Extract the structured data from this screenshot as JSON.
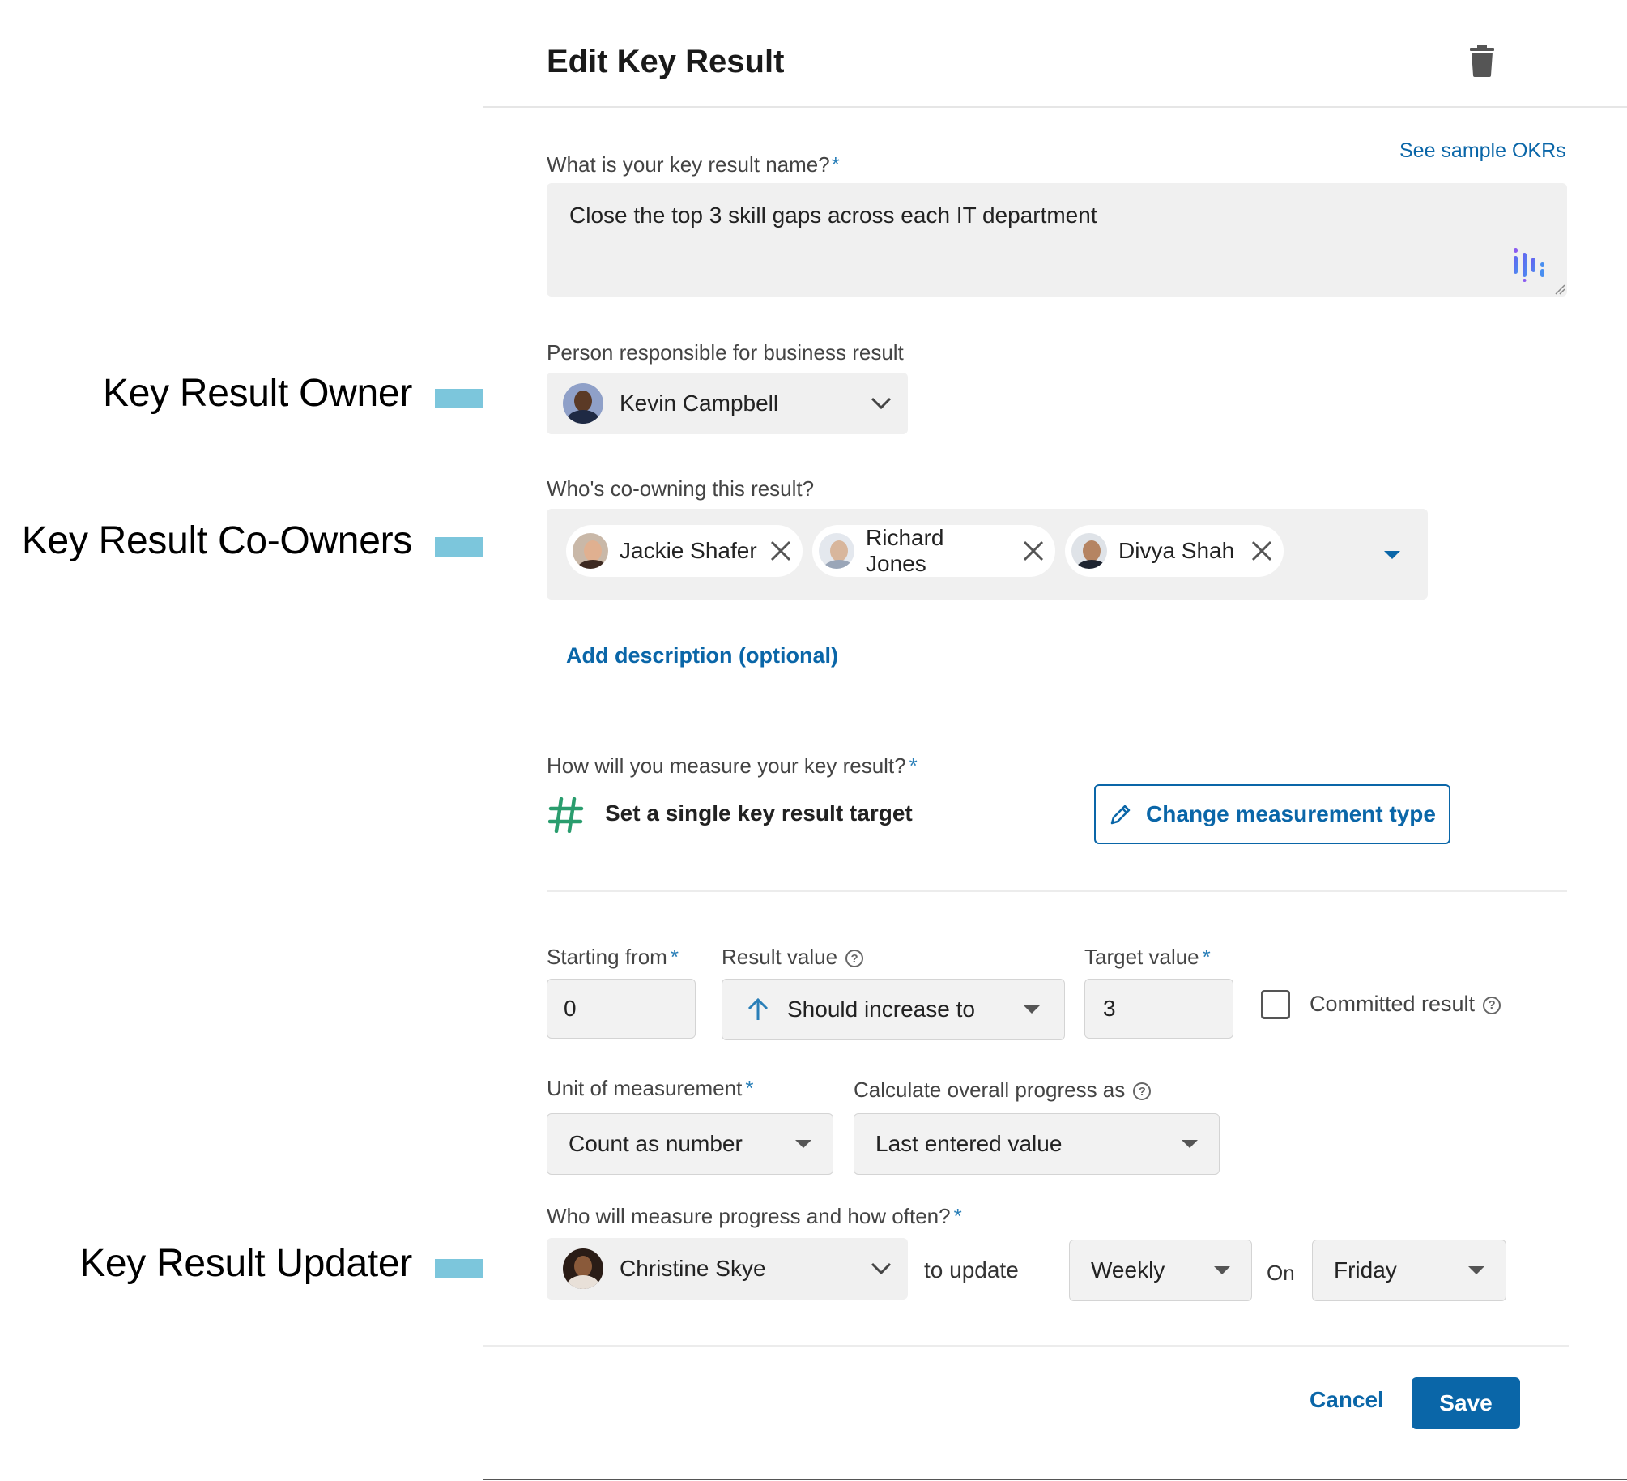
{
  "annotations": [
    {
      "label": "Key Result Owner"
    },
    {
      "label": "Key Result Co-Owners"
    },
    {
      "label": "Key Result Updater"
    }
  ],
  "header": {
    "title": "Edit Key Result"
  },
  "name_field": {
    "label": "What is your key result name?",
    "required_mark": "*",
    "sample_link": "See sample OKRs",
    "value": "Close the top 3 skill gaps across each IT department"
  },
  "owner": {
    "label": "Person responsible for business result",
    "value": "Kevin Campbell"
  },
  "co_owners": {
    "label": "Who's co-owning this result?",
    "chips": [
      {
        "name": "Jackie Shafer"
      },
      {
        "name": "Richard Jones"
      },
      {
        "name": "Divya Shah"
      }
    ]
  },
  "description_link": "Add description (optional)",
  "measure": {
    "label": "How will you measure your key result?",
    "required_mark": "*",
    "type_label": "Set a single key result target",
    "change_button": "Change measurement type"
  },
  "values": {
    "starting_label": "Starting from",
    "starting_value": "0",
    "result_label": "Result value",
    "result_value": "Should increase to",
    "target_label": "Target value",
    "target_value": "3",
    "committed_label": "Committed result",
    "committed_checked": false
  },
  "unit": {
    "label": "Unit of measurement",
    "value": "Count as number"
  },
  "progress": {
    "label": "Calculate overall progress as",
    "value": "Last entered value"
  },
  "updater": {
    "label": "Who will measure progress and how often?",
    "person": "Christine Skye",
    "to_update": "to update",
    "frequency": "Weekly",
    "on": "On",
    "day": "Friday"
  },
  "footer": {
    "cancel": "Cancel",
    "save": "Save"
  },
  "colors": {
    "accent": "#0a66a8",
    "arrow": "#7cc6dc",
    "hash": "#2a9d6e"
  }
}
